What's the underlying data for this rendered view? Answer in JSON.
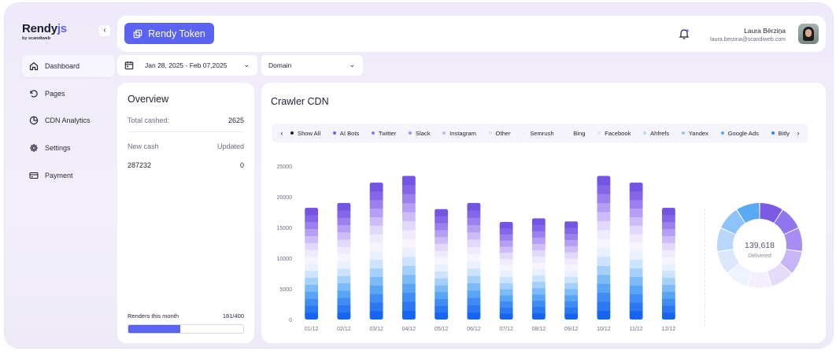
{
  "brand": {
    "name_main": "Rendy",
    "name_accent": "js",
    "sub": "by scandiweb"
  },
  "sidebar": {
    "items": [
      {
        "label": "Dashboard",
        "icon": "home-icon",
        "active": true
      },
      {
        "label": "Pages",
        "icon": "refresh-icon",
        "active": false
      },
      {
        "label": "CDN Analytics",
        "icon": "pie-chart-icon",
        "active": false
      },
      {
        "label": "Settings",
        "icon": "gear-icon",
        "active": false
      },
      {
        "label": "Payment",
        "icon": "credit-card-icon",
        "active": false
      }
    ]
  },
  "header": {
    "token_button": "Rendy Token",
    "user_name": "Laura Bērziņa",
    "user_email": "laura.berzina@scandiweb.com"
  },
  "filters": {
    "date_range": "Jan 28, 2025 - Feb 07,2025",
    "domain": "Domain"
  },
  "overview": {
    "title": "Overview",
    "total_cashed_label": "Total cashed:",
    "total_cashed_value": "2625",
    "new_cash_label": "New cash",
    "updated_label": "Updated",
    "new_cash_value": "287232",
    "updated_value": "0",
    "renders_label": "Renders this month",
    "renders_value": "181/400",
    "renders_fraction": 0.4525
  },
  "crawler": {
    "title": "Crawler CDN",
    "legend": [
      {
        "label": "Show All",
        "color": "#1f2233"
      },
      {
        "label": "AI Bots",
        "color": "#7b5be6"
      },
      {
        "label": "Twitter",
        "color": "#8f76ee"
      },
      {
        "label": "Slack",
        "color": "#a88cf2"
      },
      {
        "label": "Instagram",
        "color": "#c7b5f6"
      },
      {
        "label": "Other",
        "color": "#e4dcfa"
      },
      {
        "label": "Semrush",
        "color": "#f1eefc"
      },
      {
        "label": "Bing",
        "color": "#f3f5fd"
      },
      {
        "label": "Facebook",
        "color": "#dbe8fc"
      },
      {
        "label": "Ahfrefs",
        "color": "#b9d6fb"
      },
      {
        "label": "Yandex",
        "color": "#8ec3f9"
      },
      {
        "label": "Google Ads",
        "color": "#5aa9f5"
      },
      {
        "label": "Bitly",
        "color": "#2f86f2"
      }
    ],
    "donut_value": "139,618",
    "donut_label": "Delivered"
  },
  "chart_data": {
    "type": "bar",
    "categories": [
      "01/12",
      "02/12",
      "03/12",
      "04/12",
      "05/12",
      "06/12",
      "07/12",
      "08/12",
      "09/12",
      "10/12",
      "11/12",
      "12/12"
    ],
    "values": [
      18200,
      19000,
      22300,
      23400,
      18000,
      19000,
      15900,
      16500,
      16000,
      23400,
      22300,
      18200
    ],
    "ylim": [
      0,
      25000
    ],
    "yticks": [
      0,
      5000,
      10000,
      15000,
      20000,
      25000
    ],
    "stack_colors_bottom_to_top": [
      "#1565f0",
      "#2b78f2",
      "#3f8cf4",
      "#5aa4f6",
      "#7dbbf8",
      "#a4d0fa",
      "#cbe3fc",
      "#e8f1fd",
      "#f7f4fe",
      "#f0eafd",
      "#e2d8fb",
      "#cdbcf7",
      "#b59ef3",
      "#9c80ee",
      "#8565e8",
      "#7454e3"
    ],
    "donut_colors": [
      "#7b5be6",
      "#8f76ee",
      "#a88cf2",
      "#c7b5f6",
      "#e4dcfa",
      "#f3effd",
      "#eef4fe",
      "#dbe8fc",
      "#b9d6fb",
      "#8ec3f9",
      "#5aa9f5"
    ]
  }
}
